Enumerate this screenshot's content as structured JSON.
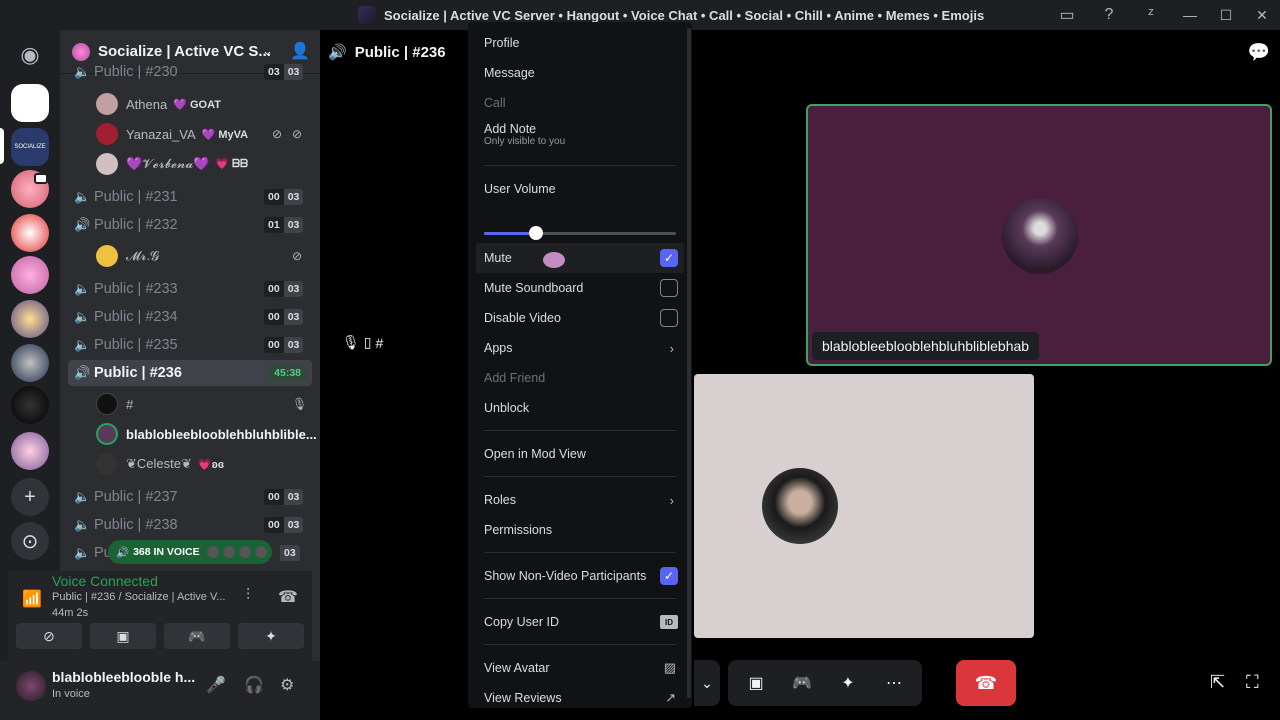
{
  "window": {
    "title": "Socialize | Active VC Server • Hangout • Voice Chat • Call • Social • Chill • Anime • Memes • Emojis",
    "icons": [
      "inbox-icon",
      "help-icon",
      "updates-icon"
    ],
    "controls": [
      "minimize",
      "maximize",
      "close"
    ],
    "minimize_glyph": "—",
    "maximize_glyph": "☐",
    "close_glyph": "✕"
  },
  "rail": {
    "home_icon": "discord-logo-icon",
    "server_label": "SOCIALIZE",
    "add_icon": "+",
    "explore_icon": "⊙"
  },
  "server": {
    "name": "Socialize | Active VC S...",
    "chevron": "⌄",
    "add_member_icon": "👤"
  },
  "channels": {
    "partial_top": {
      "label": "Public | #230",
      "c1": "03",
      "c2": "03"
    },
    "top_members": [
      {
        "name": "Athena",
        "tag": "💜 GOAT"
      },
      {
        "name": "Yanazai_VA",
        "tag": "💜 MyVA"
      },
      {
        "name": "💜𝓥𝓮𝓻𝓫𝓮𝓷𝓪💜",
        "tag": "💗 ᗷᗷ"
      }
    ],
    "c231": {
      "label": "Public | #231",
      "c1": "00",
      "c2": "03"
    },
    "c232": {
      "label": "Public | #232",
      "c1": "01",
      "c2": "03"
    },
    "c232_member": "𝓜𝓻.𝓖",
    "c233": {
      "label": "Public | #233",
      "c1": "00",
      "c2": "03"
    },
    "c234": {
      "label": "Public | #234",
      "c1": "00",
      "c2": "03"
    },
    "c235": {
      "label": "Public | #235",
      "c1": "00",
      "c2": "03"
    },
    "c236": {
      "label": "Public | #236",
      "timer": "45:38"
    },
    "c236_members": [
      {
        "name": "#"
      },
      {
        "name": "blablobleeblooblehbluhblible..."
      },
      {
        "name": "❦Celeste❦",
        "tag": "💗ʚɞ"
      }
    ],
    "c237": {
      "label": "Public | #237",
      "c1": "00",
      "c2": "03"
    },
    "c238": {
      "label": "Public | #238",
      "c1": "00",
      "c2": "03"
    },
    "c239_partial": {
      "label": "Pu",
      "c2": "03"
    }
  },
  "in_voice": {
    "label": "368 IN VOICE"
  },
  "voice_connected": {
    "status": "Voice Connected",
    "channel": "Public | #236 / Socialize | Active V...",
    "duration": "44m 2s"
  },
  "user": {
    "name": "blablobleeblooble h...",
    "status": "In voice"
  },
  "main": {
    "channel_title": "Public | #236",
    "left_tile_label": "#",
    "purple_tile_name": "blablobleeblooblehbluhbliblebhab"
  },
  "context_menu": {
    "profile": "Profile",
    "message": "Message",
    "call": "Call",
    "add_note": "Add Note",
    "add_note_sub": "Only visible to you",
    "user_volume": "User Volume",
    "user_volume_value": 0.27,
    "mute": "Mute",
    "mute_checked": true,
    "mute_soundboard": "Mute Soundboard",
    "disable_video": "Disable Video",
    "apps": "Apps",
    "add_friend": "Add Friend",
    "unblock": "Unblock",
    "open_mod_view": "Open in Mod View",
    "roles": "Roles",
    "permissions": "Permissions",
    "show_non_video": "Show Non-Video Participants",
    "show_non_video_checked": true,
    "copy_user_id": "Copy User ID",
    "id_badge": "ID",
    "view_avatar": "View Avatar",
    "view_reviews": "View Reviews"
  },
  "colors": {
    "accent": "#5865f2",
    "online_green": "#23a55a",
    "danger_red": "#da373c",
    "tile_purple": "#4a1f3d"
  }
}
